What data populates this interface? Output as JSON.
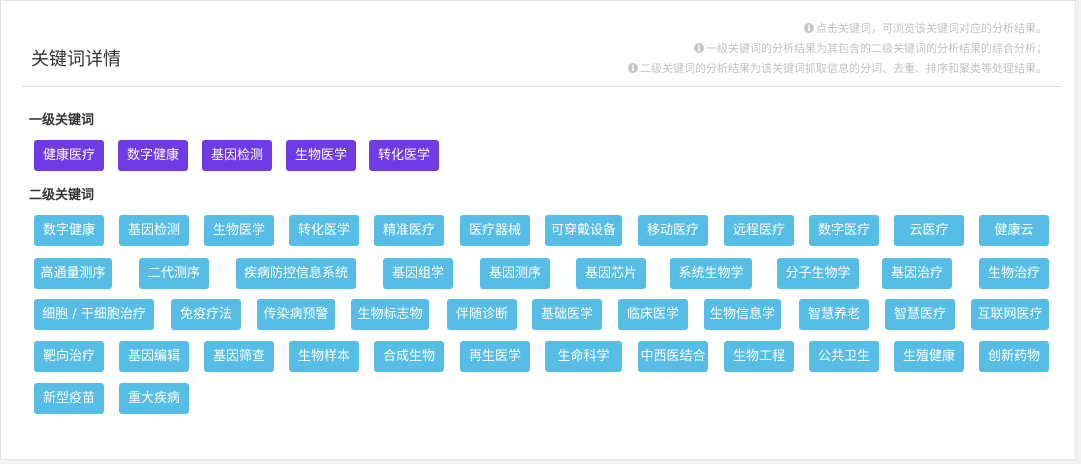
{
  "header": {
    "title": "关键词详情",
    "notes": [
      "点击关键词，可浏览该关键词对应的分析结果。",
      "一级关键词的分析结果为其包含的二级关键词的分析结果的综合分析；",
      "二级关键词的分析结果为该关键词抓取信息的分词、去重、排序和聚类等处理结果。"
    ]
  },
  "sections": {
    "primary_label": "一级关键词",
    "secondary_label": "二级关键词"
  },
  "colors": {
    "primary": "#6e3be6",
    "secondary": "#55bde6"
  },
  "primary_keywords": [
    "健康医疗",
    "数字健康",
    "基因检测",
    "生物医学",
    "转化医学"
  ],
  "secondary_keywords": [
    [
      "数字健康",
      "基因检测",
      "生物医学",
      "转化医学",
      "精准医疗",
      "医疗器械",
      "可穿戴设备",
      "移动医疗",
      "远程医疗",
      "数字医疗",
      "云医疗",
      "健康云"
    ],
    [
      "高通量测序",
      "二代测序",
      "疾病防控信息系统",
      "基因组学",
      "基因测序",
      "基因芯片",
      "系统生物学",
      "分子生物学",
      "基因治疗",
      "生物治疗"
    ],
    [
      "细胞 / 干细胞治疗",
      "免疫疗法",
      "传染病预警",
      "生物标志物",
      "伴随诊断",
      "基础医学",
      "临床医学",
      "生物信息学",
      "智慧养老",
      "智慧医疗",
      "互联网医疗"
    ],
    [
      "靶向治疗",
      "基因编辑",
      "基因筛查",
      "生物样本",
      "合成生物",
      "再生医学",
      "生命科学",
      "中西医结合",
      "生物工程",
      "公共卫生",
      "生殖健康",
      "创新药物"
    ],
    [
      "新型疫苗",
      "重大疾病"
    ]
  ]
}
